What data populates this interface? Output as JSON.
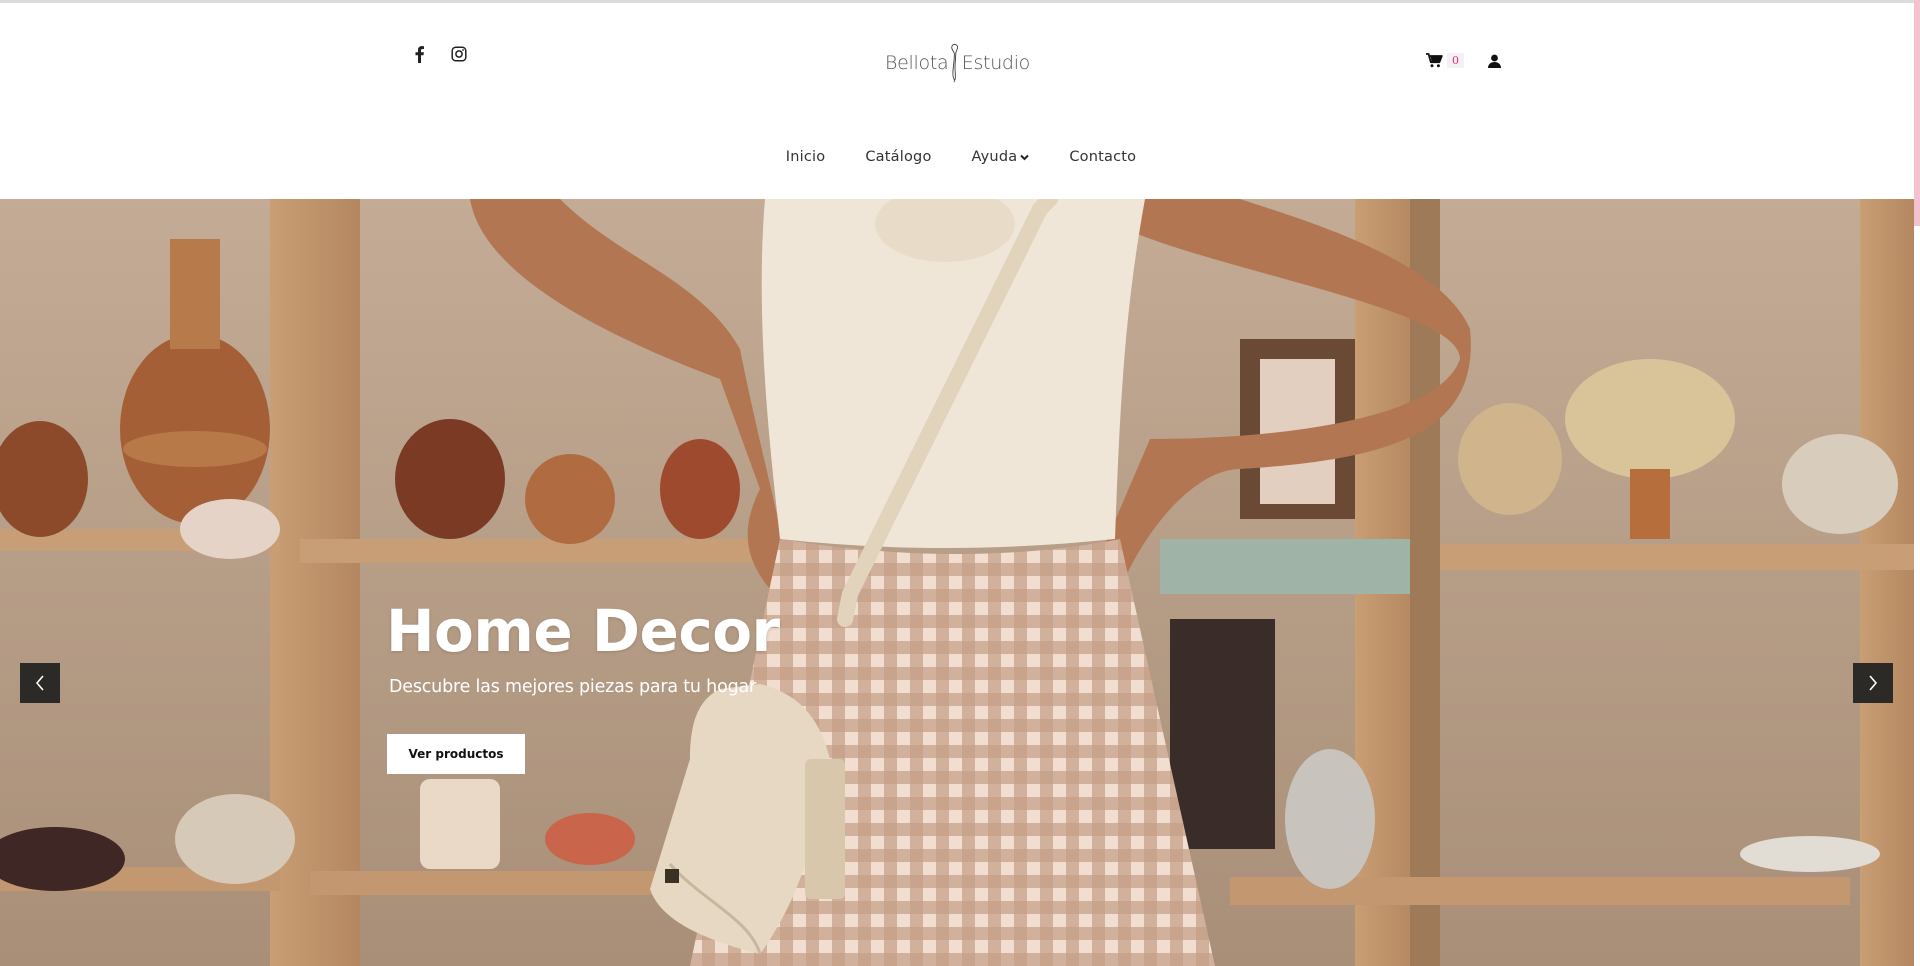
{
  "header": {
    "social": [
      {
        "icon": "facebook-icon"
      },
      {
        "icon": "instagram-icon"
      }
    ],
    "logo": {
      "word1": "Bellota",
      "word2": "Estudio"
    },
    "cart": {
      "count": "0",
      "icon": "cart-icon"
    },
    "account": {
      "icon": "user-icon"
    }
  },
  "nav": {
    "items": [
      {
        "label": "Inicio"
      },
      {
        "label": "Catálogo"
      },
      {
        "label": "Ayuda",
        "has_dropdown": true
      },
      {
        "label": "Contacto"
      }
    ]
  },
  "hero": {
    "title": "Home Decor",
    "subtitle": "Descubre las mejores piezas para tu hogar",
    "button_label": "Ver productos",
    "prev_icon": "chevron-left-icon",
    "next_icon": "chevron-right-icon"
  },
  "colors": {
    "accent": "#e0307a",
    "scrollbar": "#f4c2cf",
    "slider_arrow_bg": "#2c2a27"
  }
}
